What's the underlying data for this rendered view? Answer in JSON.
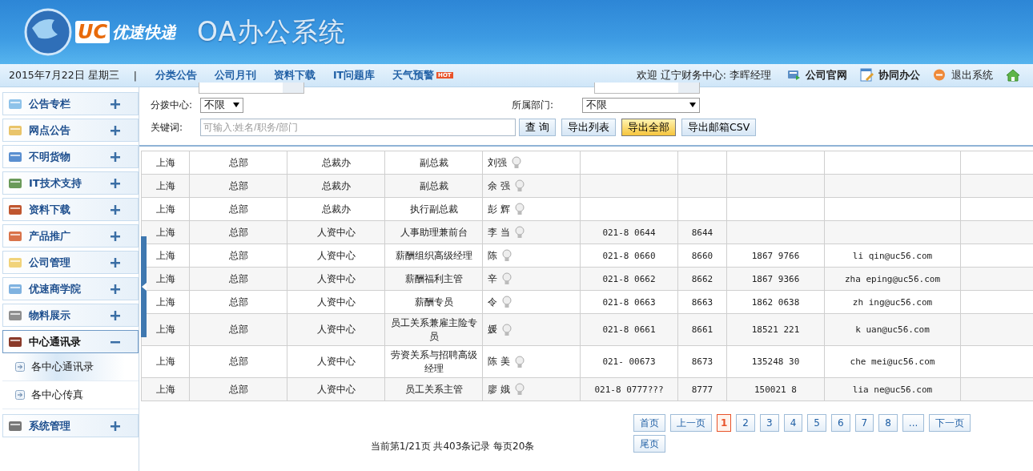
{
  "header": {
    "logo_mark": "UC",
    "logo_text": "优速快递",
    "system_title": "OA办公系统"
  },
  "nav": {
    "date": "2015年7月22日 星期三",
    "separator": "|",
    "links": [
      {
        "label": "分类公告"
      },
      {
        "label": "公司月刊"
      },
      {
        "label": "资料下载"
      },
      {
        "label": "IT问题库"
      },
      {
        "label": "天气预警",
        "badge": "HOT"
      }
    ],
    "welcome": "欢迎 辽宁财务中心: 李晖经理",
    "actions": [
      {
        "label": "公司官网",
        "kind": "site",
        "bold": true
      },
      {
        "label": "协同办公",
        "kind": "cowork",
        "bold": true
      },
      {
        "label": "退出系统",
        "kind": "logout",
        "bold": false
      },
      {
        "kind": "home"
      }
    ]
  },
  "sidebar": {
    "items": [
      {
        "label": "公告专栏",
        "expanded": false
      },
      {
        "label": "网点公告",
        "expanded": false
      },
      {
        "label": "不明货物",
        "expanded": false
      },
      {
        "label": "IT技术支持",
        "expanded": false
      },
      {
        "label": "资料下载",
        "expanded": false
      },
      {
        "label": "产品推广",
        "expanded": false
      },
      {
        "label": "公司管理",
        "expanded": false
      },
      {
        "label": "优速商学院",
        "expanded": false
      },
      {
        "label": "物料展示",
        "expanded": false
      },
      {
        "label": "中心通讯录",
        "expanded": true,
        "children": [
          {
            "label": "各中心通讯录",
            "selected": true
          },
          {
            "label": "各中心传真",
            "selected": false
          }
        ]
      },
      {
        "label": "系统管理",
        "expanded": false
      }
    ]
  },
  "filters": {
    "selects": [
      {
        "label": "分拨中心:",
        "value": "不限"
      },
      {
        "label": "所属部门:",
        "value": "不限"
      }
    ],
    "keyword": {
      "label": "关键词:",
      "placeholder": "可输入:姓名/职务/部门"
    },
    "buttons": [
      {
        "label": "查 询",
        "highlighted": false
      },
      {
        "label": "导出列表",
        "highlighted": false
      },
      {
        "label": "导出全部",
        "highlighted": true
      },
      {
        "label": "导出邮箱CSV",
        "highlighted": false
      }
    ]
  },
  "table": {
    "rows": [
      {
        "cells": [
          "上海",
          "总部",
          "总裁办",
          "副总裁"
        ],
        "name": "刘强"
      },
      {
        "cells": [
          "上海",
          "总部",
          "总裁办",
          "副总裁"
        ],
        "name": "余 强"
      },
      {
        "cells": [
          "上海",
          "总部",
          "总裁办",
          "执行副总裁"
        ],
        "name": "彭 辉"
      },
      {
        "cells": [
          "上海",
          "总部",
          "人资中心",
          "人事助理兼前台"
        ],
        "name": "李 当",
        "phone": "021-8 0644",
        "ext": "8644"
      },
      {
        "cells": [
          "上海",
          "总部",
          "人资中心",
          "薪酬组织高级经理"
        ],
        "name": "陈",
        "phone": "021-8 0660",
        "ext": "8660",
        "mobile": "1867 9766",
        "email": "li qin@uc56.com"
      },
      {
        "cells": [
          "上海",
          "总部",
          "人资中心",
          "薪酬福利主管"
        ],
        "name": "辛",
        "phone": "021-8 0662",
        "ext": "8662",
        "mobile": "1867 9366",
        "email": "zha eping@uc56.com"
      },
      {
        "cells": [
          "上海",
          "总部",
          "人资中心",
          "薪酬专员"
        ],
        "name": "令",
        "phone": "021-8 0663",
        "ext": "8663",
        "mobile": "1862 0638",
        "email": "zh ing@uc56.com"
      },
      {
        "cells": [
          "上海",
          "总部",
          "人资中心",
          "员工关系兼雇主险专员"
        ],
        "name": "媛",
        "phone": "021-8 0661",
        "ext": "8661",
        "mobile": "18521 221",
        "email": "k uan@uc56.com"
      },
      {
        "cells": [
          "上海",
          "总部",
          "人资中心",
          "劳资关系与招聘高级经理"
        ],
        "name": "陈 美",
        "phone": "021- 00673",
        "ext": "8673",
        "mobile": "135248 30",
        "email": "che mei@uc56.com"
      },
      {
        "cells": [
          "上海",
          "总部",
          "人资中心",
          "员工关系主管"
        ],
        "name": "廖 娥",
        "phone": "021-8 0777???",
        "ext": "8777",
        "mobile": "150021 8",
        "email": "lia ne@uc56.com"
      }
    ]
  },
  "pagination": {
    "pages": [
      {
        "label": "首页",
        "selected": false
      },
      {
        "label": "上一页",
        "selected": false
      },
      {
        "label": "1",
        "selected": true
      },
      {
        "label": "2",
        "selected": false
      },
      {
        "label": "3",
        "selected": false
      },
      {
        "label": "4",
        "selected": false
      },
      {
        "label": "5",
        "selected": false
      },
      {
        "label": "6",
        "selected": false
      },
      {
        "label": "7",
        "selected": false
      },
      {
        "label": "8",
        "selected": false
      },
      {
        "label": "...",
        "selected": false
      },
      {
        "label": "下一页",
        "selected": false
      },
      {
        "label": "尾页",
        "selected": false
      }
    ],
    "summary": "当前第1/21页 共403条记录 每页20条"
  }
}
